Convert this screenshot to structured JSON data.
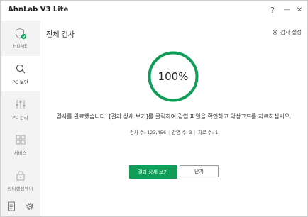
{
  "window": {
    "title": "AhnLab V3 Lite",
    "help": "?",
    "minimize": "—",
    "close": "✕"
  },
  "sidebar": {
    "items": [
      {
        "label": "HOME",
        "icon": "shield-check-icon"
      },
      {
        "label": "PC 보안",
        "icon": "search-icon"
      },
      {
        "label": "PC 관리",
        "icon": "sliders-icon"
      },
      {
        "label": "서비스",
        "icon": "grid-icon"
      },
      {
        "label": "안티랜섬웨어",
        "icon": "lock-icon"
      }
    ],
    "bottom": [
      "document-icon",
      "gear-icon"
    ]
  },
  "main": {
    "title": "전체 검사",
    "settings_label": "검사 설정",
    "progress_text": "100%",
    "progress": 1.0,
    "message": "검사를 완료했습니다. [결과 상세 보기]를 클릭하여 감염 파일을 확인하고 악성코드를 치료하십시오.",
    "stats": {
      "scanned": "검사 수: 123,456",
      "infected": "감염 수: 3",
      "treated": "치료 수: 1"
    },
    "primary_button": "결과 상세 보기",
    "secondary_button": "닫기"
  },
  "colors": {
    "accent": "#0f9d58",
    "sidebar_bg": "#f3f3f3"
  }
}
